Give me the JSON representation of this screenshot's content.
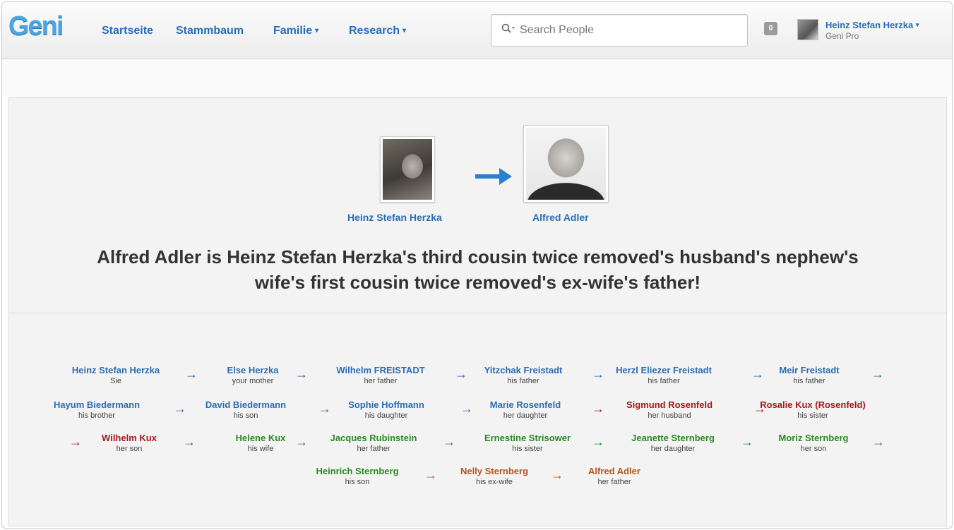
{
  "header": {
    "logo": "Geni",
    "nav": [
      {
        "label": "Startseite",
        "caret": ""
      },
      {
        "label": "Stammbaum",
        "caret": ""
      },
      {
        "label": "Familie",
        "caret": "▾"
      },
      {
        "label": "Research",
        "caret": "▾"
      }
    ],
    "search_placeholder": "Search People",
    "notification_count": "0",
    "user_name": "Heinz Stefan Herzka",
    "user_plan": "Geni Pro"
  },
  "relationship": {
    "from_name": "Heinz Stefan Herzka",
    "to_name": "Alfred Adler",
    "headline_line1": "Alfred Adler is Heinz Stefan Herzka's third cousin twice removed's husband's nephew's",
    "headline_line2": "wife's first cousin twice removed's ex-wife's father!"
  },
  "colors": {
    "blue": "#2a6db5",
    "red": "#a8161b",
    "green": "#2a8a23",
    "orange": "#b1581c"
  },
  "chain": [
    {
      "name": "Heinz Stefan Herzka",
      "role": "Sie",
      "color": "blue"
    },
    {
      "name": "Else Herzka",
      "role": "your mother",
      "color": "blue"
    },
    {
      "name": "Wilhelm FREISTADT",
      "role": "her father",
      "color": "blue"
    },
    {
      "name": "Yitzchak Freistadt",
      "role": "his father",
      "color": "blue"
    },
    {
      "name": "Herzl Eliezer Freistadt",
      "role": "his father",
      "color": "blue"
    },
    {
      "name": "Meir Freistadt",
      "role": "his father",
      "color": "blue"
    },
    {
      "name": "Hayum Biedermann",
      "role": "his brother",
      "color": "blue"
    },
    {
      "name": "David Biedermann",
      "role": "his son",
      "color": "blue"
    },
    {
      "name": "Sophie Hoffmann",
      "role": "his daughter",
      "color": "blue"
    },
    {
      "name": "Marie Rosenfeld",
      "role": "her daughter",
      "color": "blue"
    },
    {
      "name": "Sigmund Rosenfeld",
      "role": "her husband",
      "color": "red"
    },
    {
      "name": "Rosalie Kux (Rosenfeld)",
      "role": "his sister",
      "color": "red"
    },
    {
      "name": "Wilhelm Kux",
      "role": "her son",
      "color": "red"
    },
    {
      "name": "Helene Kux",
      "role": "his wife",
      "color": "green"
    },
    {
      "name": "Jacques Rubinstein",
      "role": "her father",
      "color": "green"
    },
    {
      "name": "Ernestine Strisower",
      "role": "his sister",
      "color": "green"
    },
    {
      "name": "Jeanette Sternberg",
      "role": "her daughter",
      "color": "green"
    },
    {
      "name": "Moriz Sternberg",
      "role": "her son",
      "color": "green"
    },
    {
      "name": "Heinrich Sternberg",
      "role": "his son",
      "color": "green"
    },
    {
      "name": "Nelly Sternberg",
      "role": "his ex-wife",
      "color": "orange"
    },
    {
      "name": "Alfred Adler",
      "role": "her father",
      "color": "orange"
    }
  ],
  "arrow_glyph": "→"
}
